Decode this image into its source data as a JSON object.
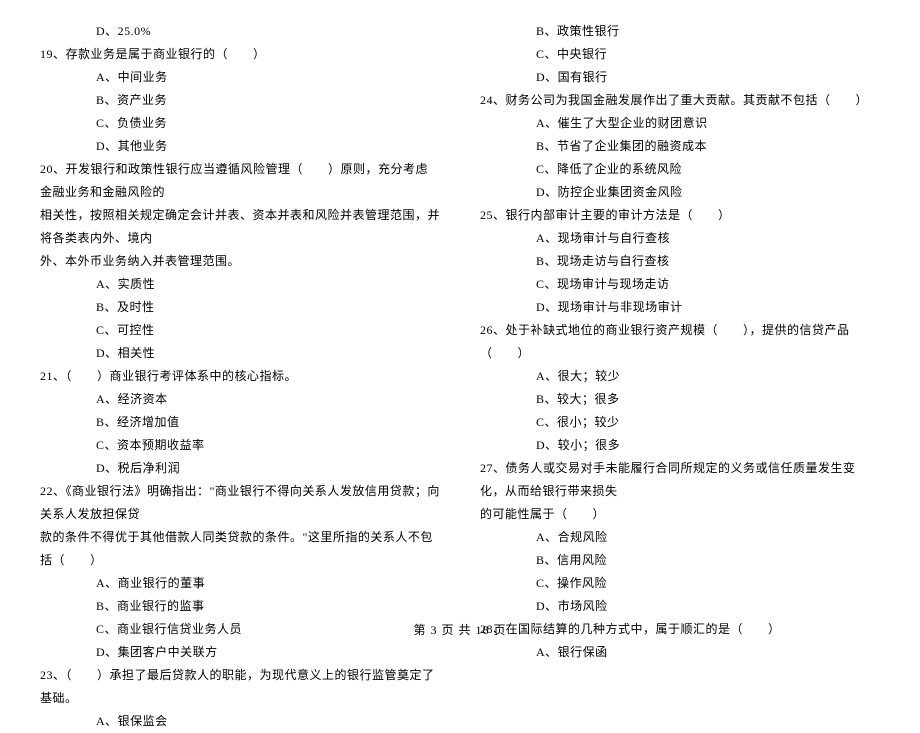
{
  "left": {
    "d18": "D、25.0%",
    "q19": "19、存款业务是属于商业银行的（　　）",
    "q19a": "A、中间业务",
    "q19b": "B、资产业务",
    "q19c": "C、负债业务",
    "q19d": "D、其他业务",
    "q20l1": "20、开发银行和政策性银行应当遵循风险管理（　　）原则，充分考虑金融业务和金融风险的",
    "q20l2": "相关性，按照相关规定确定会计并表、资本并表和风险并表管理范围，并将各类表内外、境内",
    "q20l3": "外、本外币业务纳入并表管理范围。",
    "q20a": "A、实质性",
    "q20b": "B、及时性",
    "q20c": "C、可控性",
    "q20d": "D、相关性",
    "q21": "21、（　　）商业银行考评体系中的核心指标。",
    "q21a": "A、经济资本",
    "q21b": "B、经济增加值",
    "q21c": "C、资本预期收益率",
    "q21d": "D、税后净利润",
    "q22l1": "22、《商业银行法》明确指出：\"商业银行不得向关系人发放信用贷款；向关系人发放担保贷",
    "q22l2": "款的条件不得优于其他借款人同类贷款的条件。\"这里所指的关系人不包括（　　）",
    "q22a": "A、商业银行的董事",
    "q22b": "B、商业银行的监事",
    "q22c": "C、商业银行信贷业务人员",
    "q22d": "D、集团客户中关联方",
    "q23": "23、（　　）承担了最后贷款人的职能，为现代意义上的银行监管奠定了基础。",
    "q23a": "A、银保监会"
  },
  "right": {
    "q23b": "B、政策性银行",
    "q23c": "C、中央银行",
    "q23d": "D、国有银行",
    "q24": "24、财务公司为我国金融发展作出了重大贡献。其贡献不包括（　　）",
    "q24a": "A、催生了大型企业的财团意识",
    "q24b": "B、节省了企业集团的融资成本",
    "q24c": "C、降低了企业的系统风险",
    "q24d": "D、防控企业集团资金风险",
    "q25": "25、银行内部审计主要的审计方法是（　　）",
    "q25a": "A、现场审计与自行查核",
    "q25b": "B、现场走访与自行查核",
    "q25c": "C、现场审计与现场走访",
    "q25d": "D、现场审计与非现场审计",
    "q26": "26、处于补缺式地位的商业银行资产规模（　　），提供的信贷产品（　　）",
    "q26a": "A、很大；较少",
    "q26b": "B、较大；很多",
    "q26c": "C、很小；较少",
    "q26d": "D、较小；很多",
    "q27l1": "27、债务人或交易对手未能履行合同所规定的义务或信任质量发生变化，从而给银行带来损失",
    "q27l2": "的可能性属于（　　）",
    "q27a": "A、合规风险",
    "q27b": "B、信用风险",
    "q27c": "C、操作风险",
    "q27d": "D、市场风险",
    "q28": "28、在国际结算的几种方式中，属于顺汇的是（　　）",
    "q28a": "A、银行保函"
  },
  "footer": "第 3 页 共 18 页"
}
